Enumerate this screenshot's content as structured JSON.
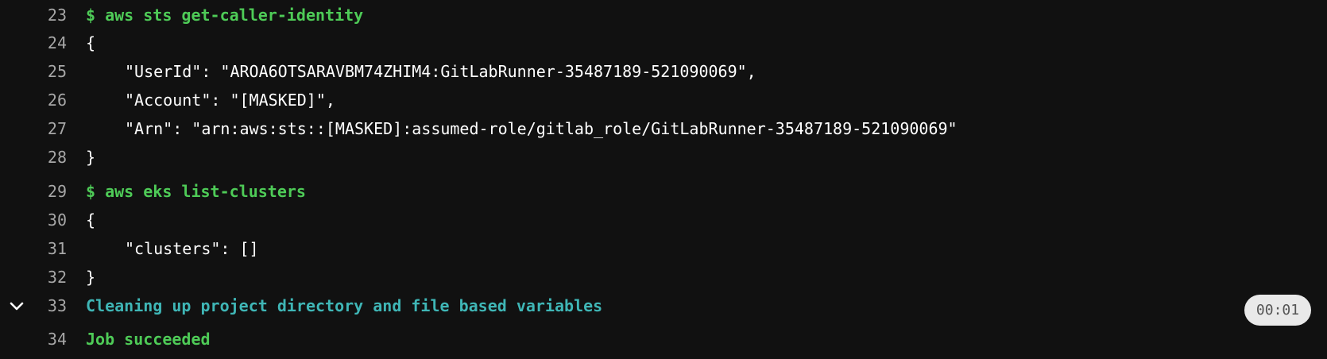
{
  "log": {
    "lines": [
      {
        "number": "23",
        "text": "$ aws sts get-caller-identity"
      },
      {
        "number": "24",
        "text": "{"
      },
      {
        "number": "25",
        "text": "\"UserId\": \"AROA6OTSARAVBM74ZHIM4:GitLabRunner-35487189-521090069\","
      },
      {
        "number": "26",
        "text": "\"Account\": \"[MASKED]\","
      },
      {
        "number": "27",
        "text": "\"Arn\": \"arn:aws:sts::[MASKED]:assumed-role/gitlab_role/GitLabRunner-35487189-521090069\""
      },
      {
        "number": "28",
        "text": "}"
      },
      {
        "number": "29",
        "text": "$ aws eks list-clusters"
      },
      {
        "number": "30",
        "text": "{"
      },
      {
        "number": "31",
        "text": "\"clusters\": []"
      },
      {
        "number": "32",
        "text": "}"
      },
      {
        "number": "33",
        "text": "Cleaning up project directory and file based variables"
      },
      {
        "number": "34",
        "text": "Job succeeded"
      }
    ],
    "section_duration": "00:01"
  },
  "colors": {
    "background": "#111111",
    "command": "#4ecb57",
    "section_header": "#3fb6b6",
    "line_number": "#a7a7a7",
    "duration_badge": "#e9e9e9"
  },
  "icons": {
    "section_toggle": "chevron-down-icon"
  }
}
